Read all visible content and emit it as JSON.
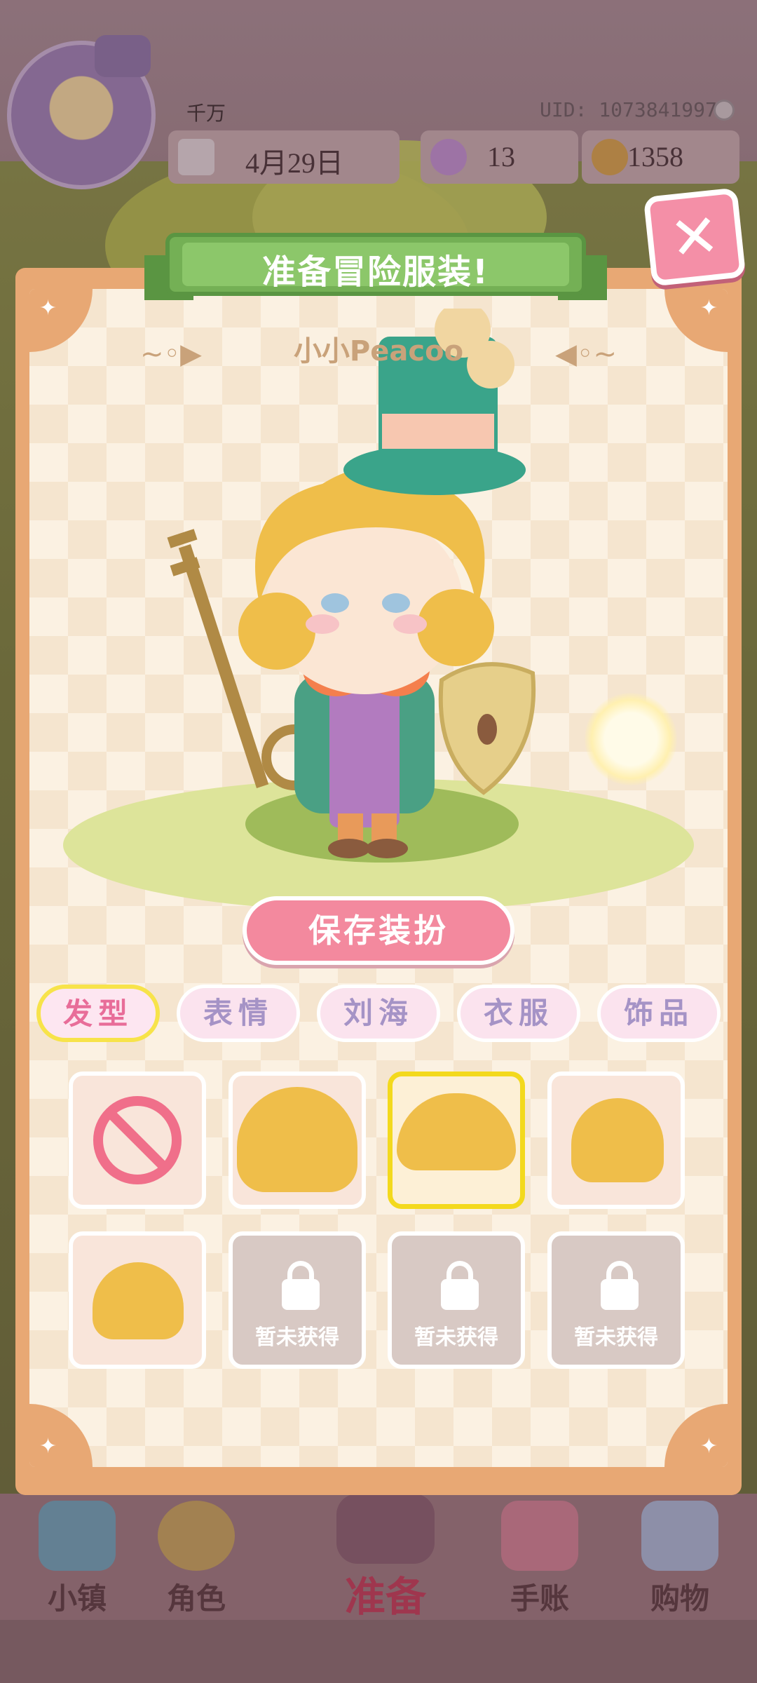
{
  "header": {
    "player_name": "千万",
    "uid": "UID: 1073841997",
    "date": "4月29日",
    "gems": "13",
    "coins": "1358"
  },
  "dialog": {
    "title": "准备冒险服装!",
    "character_name": "小小Peacoo",
    "save_label": "保存装扮",
    "close_icon": "close-icon"
  },
  "tabs": [
    {
      "label": "发型",
      "active": true
    },
    {
      "label": "表情",
      "active": false
    },
    {
      "label": "刘海",
      "active": false
    },
    {
      "label": "衣服",
      "active": false
    },
    {
      "label": "饰品",
      "active": false
    }
  ],
  "items": [
    {
      "type": "none",
      "icon": "no-hair-icon"
    },
    {
      "type": "hair",
      "icon": "hair-round-icon"
    },
    {
      "type": "hair",
      "icon": "hair-bob-icon",
      "selected": true
    },
    {
      "type": "hair",
      "icon": "hair-messy-icon"
    },
    {
      "type": "hair",
      "icon": "hair-small-icon"
    },
    {
      "type": "locked",
      "label": "暂未获得"
    },
    {
      "type": "locked",
      "label": "暂未获得"
    },
    {
      "type": "locked",
      "label": "暂未获得"
    }
  ],
  "bottom_nav": [
    {
      "label": "小镇",
      "icon": "map-icon"
    },
    {
      "label": "角色",
      "icon": "character-icon"
    },
    {
      "label": "准备",
      "icon": "prepare-icon"
    },
    {
      "label": "手账",
      "icon": "notebook-icon"
    },
    {
      "label": "购物",
      "icon": "shopping-bag-icon"
    }
  ],
  "colors": {
    "accent_pink": "#f3899e",
    "banner_green": "#74b055",
    "panel_frame": "#e8a874",
    "hair_gold": "#efbe4a",
    "selected_border": "#f3d91d"
  }
}
